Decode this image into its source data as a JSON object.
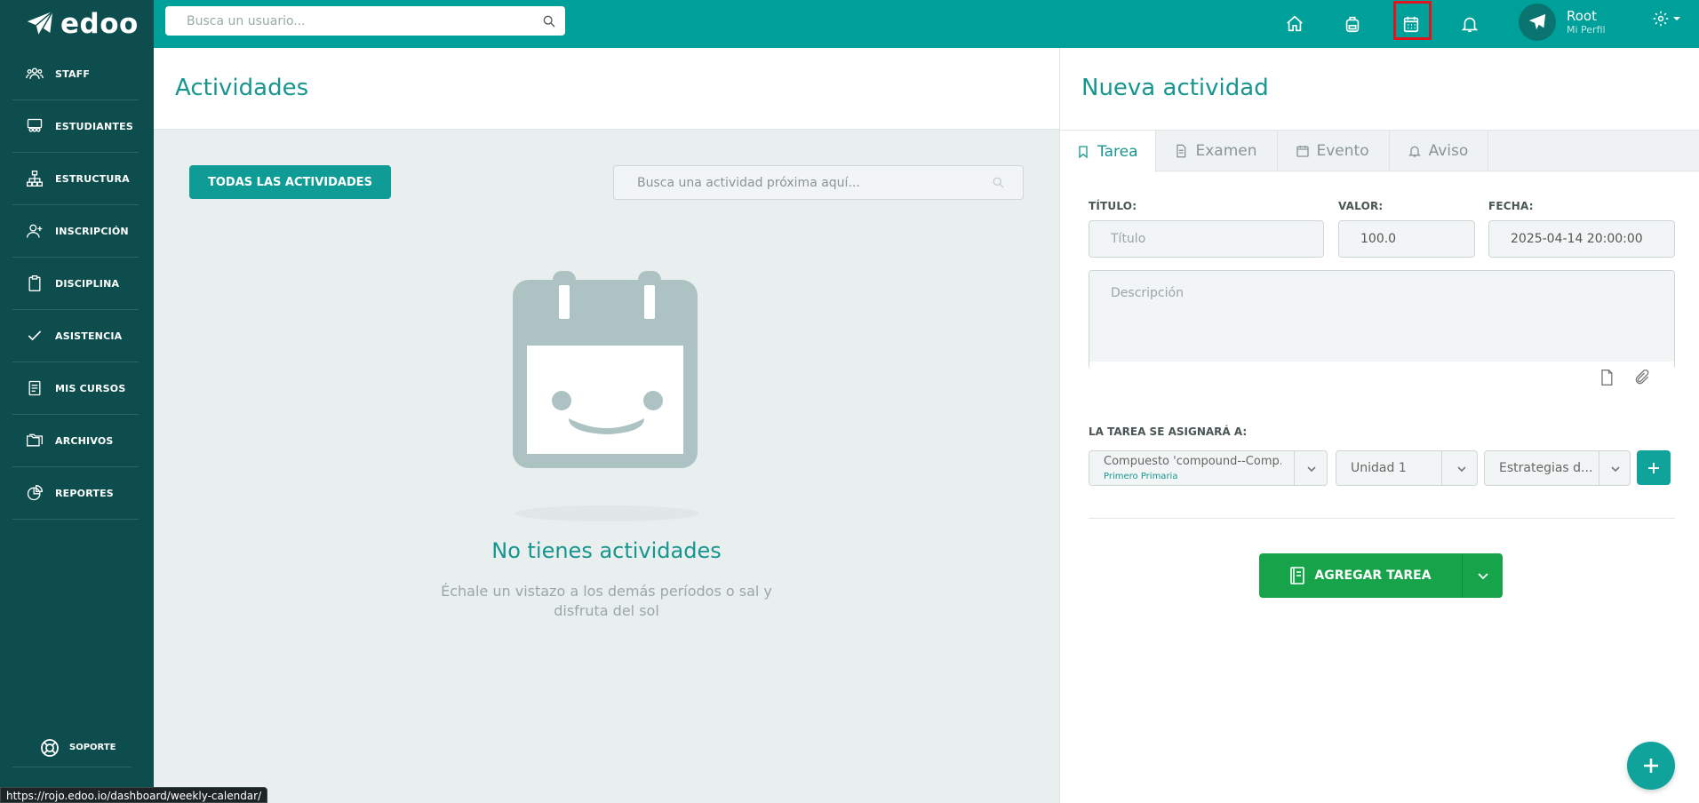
{
  "brand": {
    "name": "edoo"
  },
  "sidebar": {
    "items": [
      {
        "label": "STAFF",
        "icon": "staff-icon"
      },
      {
        "label": "ESTUDIANTES",
        "icon": "students-icon"
      },
      {
        "label": "ESTRUCTURA",
        "icon": "structure-icon"
      },
      {
        "label": "INSCRIPCIÓN",
        "icon": "enroll-icon"
      },
      {
        "label": "DISCIPLINA",
        "icon": "clipboard-icon"
      },
      {
        "label": "ASISTENCIA",
        "icon": "check-icon"
      },
      {
        "label": "MIS CURSOS",
        "icon": "courses-icon"
      },
      {
        "label": "ARCHIVOS",
        "icon": "folders-icon"
      },
      {
        "label": "REPORTES",
        "icon": "reports-icon"
      }
    ],
    "support_label": "SOPORTE"
  },
  "statusbar": {
    "url": "https://rojo.edoo.io/dashboard/weekly-calendar/"
  },
  "topbar": {
    "search_placeholder": "Busca un usuario...",
    "icons": [
      "home-icon",
      "backpack-icon",
      "calendar-icon",
      "bell-icon"
    ],
    "profile": {
      "name": "Root",
      "subtitle": "Mi Perfil"
    }
  },
  "activities": {
    "title": "Actividades",
    "all_button": "TODAS LAS ACTIVIDADES",
    "search_placeholder": "Busca una actividad próxima aquí...",
    "empty_title": "No tienes actividades",
    "empty_subtitle": "Échale un vistazo a los demás períodos o sal y disfruta del sol"
  },
  "new_activity": {
    "title": "Nueva actividad",
    "tabs": [
      {
        "label": "Tarea",
        "icon": "bookmark-icon",
        "active": true
      },
      {
        "label": "Examen",
        "icon": "document-icon",
        "active": false
      },
      {
        "label": "Evento",
        "icon": "calendar-icon",
        "active": false
      },
      {
        "label": "Aviso",
        "icon": "bell-icon",
        "active": false
      }
    ],
    "fields": {
      "title_label": "TÍTULO:",
      "title_placeholder": "Título",
      "value_label": "VALOR:",
      "value": "100.0",
      "date_label": "FECHA:",
      "date": "2025-04-14 20:00:00",
      "description_placeholder": "Descripción"
    },
    "assign_label": "LA TAREA SE ASIGNARÁ A:",
    "assign": {
      "course": "Compuesto 'compound--Comp...",
      "course_sub": "Primero Primaria",
      "unit": "Unidad 1",
      "strategy": "Estrategias d..."
    },
    "submit_label": "AGREGAR TAREA"
  },
  "colors": {
    "primary": "#00a09a",
    "sidebar": "#0d4d4d",
    "success": "#16a34a",
    "highlight": "#e0141c"
  }
}
